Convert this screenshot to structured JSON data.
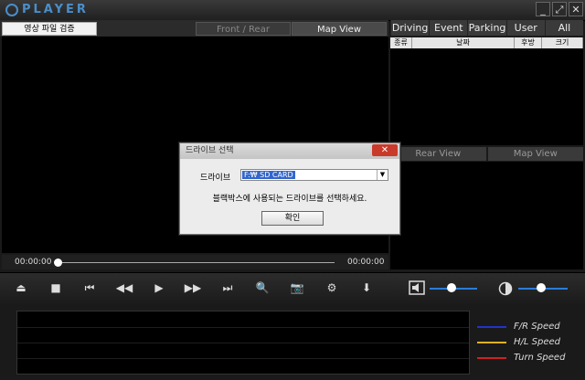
{
  "app": {
    "title": "PLAYER"
  },
  "window_buttons": {
    "minimize": "_",
    "maximize": "⤢",
    "close": "✕"
  },
  "left_panel": {
    "verify_button": "영상 파일 검증",
    "tabs": [
      "Front / Rear",
      "Map View"
    ],
    "time_start": "00:00:00",
    "time_end": "00:00:00"
  },
  "right_panel": {
    "tabs": [
      "Driving",
      "Event",
      "Parking",
      "User",
      "All"
    ],
    "columns": [
      "종류",
      "날짜",
      "후방",
      "크기"
    ],
    "view_tabs": [
      "Rear View",
      "Map View"
    ]
  },
  "controls": {
    "eject": "⏏",
    "stop": "■",
    "first": "⏮",
    "rewind": "◀◀",
    "play": "▶",
    "forward": "▶▶",
    "last": "⏭",
    "zoom": "🔍",
    "camera": "📷",
    "settings": "⚙",
    "save": "⬇"
  },
  "legend": [
    {
      "label": "F/R Speed",
      "color": "#2233cc"
    },
    {
      "label": "H/L Speed",
      "color": "#e0b020"
    },
    {
      "label": "Turn Speed",
      "color": "#cc2222"
    }
  ],
  "dialog": {
    "title": "드라이브 선택",
    "drive_label": "드라이브",
    "drive_value": "F:₩ SD CARD",
    "message": "블랙박스에 사용되는 드라이브를 선택하세요.",
    "ok_label": "확인",
    "close_label": "✕"
  },
  "colors": {
    "accent": "#2b7dd8",
    "logo": "#4a8ec9"
  }
}
